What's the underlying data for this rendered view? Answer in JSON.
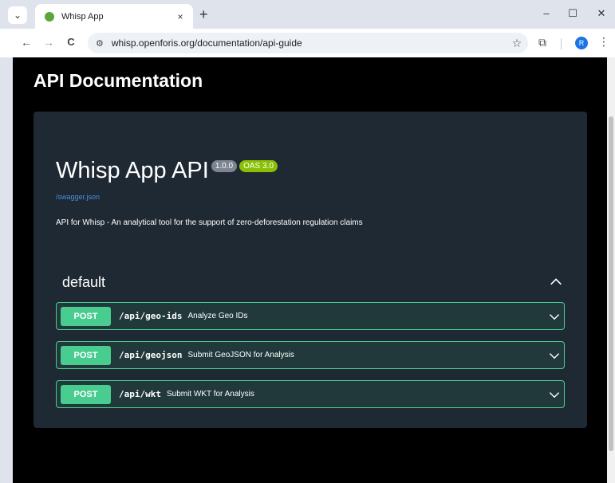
{
  "browser": {
    "tab_title": "Whisp App",
    "tab_close": "×",
    "new_tab": "+",
    "minimize": "–",
    "maximize": "☐",
    "close": "✕",
    "url": "whisp.openforis.org/documentation/api-guide",
    "profile_initial": "R",
    "icons": {
      "back": "←",
      "forward": "→",
      "reload": "C",
      "site_info": "⚙",
      "bookmark": "☆",
      "extensions": "⧉",
      "menu": "⋮",
      "tab_search": "⌄"
    }
  },
  "page": {
    "title": "API Documentation",
    "api": {
      "name": "Whisp App API",
      "version": "1.0.0",
      "oas": "OAS 3.0",
      "spec_link": "/swagger.json",
      "description": "API for Whisp - An analytical tool for the support of zero-deforestation regulation claims"
    },
    "group": {
      "name": "default",
      "operations": [
        {
          "method": "POST",
          "path": "/api/geo-ids",
          "summary": "Analyze Geo IDs"
        },
        {
          "method": "POST",
          "path": "/api/geojson",
          "summary": "Submit GeoJSON for Analysis"
        },
        {
          "method": "POST",
          "path": "/api/wkt",
          "summary": "Submit WKT for Analysis"
        }
      ]
    }
  },
  "colors": {
    "post": "#49cc90",
    "link": "#4990e2",
    "card_bg": "#1f2933",
    "badge_version": "#7d8492",
    "badge_oas": "#89bf04"
  }
}
